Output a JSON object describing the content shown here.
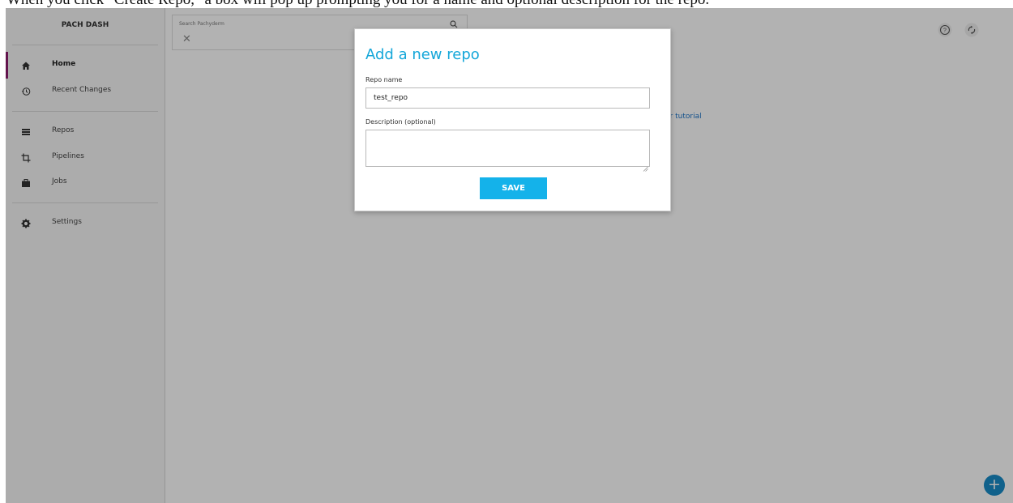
{
  "caption": "When you click \"Create Repo,\" a box will pop up prompting you for a name and optional description for the repo.",
  "sidebar": {
    "brand": "PACH DASH",
    "items": [
      {
        "label": "Home",
        "icon": "home-icon"
      },
      {
        "label": "Recent Changes",
        "icon": "history-icon"
      },
      {
        "label": "Repos",
        "icon": "list-icon"
      },
      {
        "label": "Pipelines",
        "icon": "crop-icon"
      },
      {
        "label": "Jobs",
        "icon": "briefcase-icon"
      },
      {
        "label": "Settings",
        "icon": "gear-icon"
      }
    ],
    "active": "Home"
  },
  "search": {
    "placeholder": "Search Pachyderm"
  },
  "main": {
    "tutorial_link": "er tutorial"
  },
  "modal": {
    "title": "Add a new repo",
    "repo_name_label": "Repo name",
    "repo_name_value": "test_repo",
    "description_label": "Description (optional)",
    "description_value": "",
    "save_label": "SAVE"
  },
  "fab": {
    "label": "+"
  },
  "colors": {
    "accent": "#15a7d9",
    "save_button": "#14b2ea",
    "active_nav": "#8e1d6f",
    "fab": "#178bc7"
  }
}
